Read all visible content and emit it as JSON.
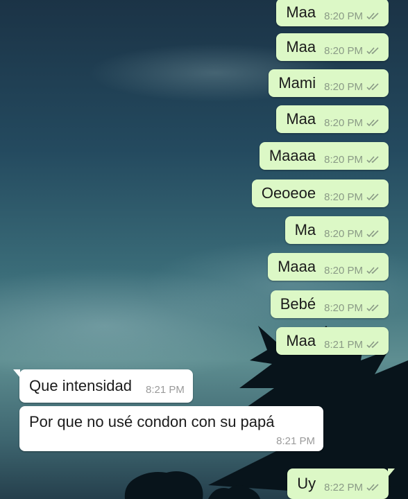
{
  "colors": {
    "outgoing_bubble": "#dcf8c6",
    "incoming_bubble": "#ffffff",
    "tick": "#8a9a86"
  },
  "messages": [
    {
      "direction": "out",
      "text": "Maa",
      "time": "8:20 PM",
      "status": "double-tick-icon"
    },
    {
      "direction": "out",
      "text": "Maa",
      "time": "8:20 PM",
      "status": "double-tick-icon"
    },
    {
      "direction": "out",
      "text": "Mami",
      "time": "8:20 PM",
      "status": "double-tick-icon"
    },
    {
      "direction": "out",
      "text": "Maa",
      "time": "8:20 PM",
      "status": "double-tick-icon"
    },
    {
      "direction": "out",
      "text": "Maaaa",
      "time": "8:20 PM",
      "status": "double-tick-icon"
    },
    {
      "direction": "out",
      "text": "Oeoeoe",
      "time": "8:20 PM",
      "status": "double-tick-icon"
    },
    {
      "direction": "out",
      "text": "Ma",
      "time": "8:20 PM",
      "status": "double-tick-icon"
    },
    {
      "direction": "out",
      "text": "Maaa",
      "time": "8:20 PM",
      "status": "double-tick-icon"
    },
    {
      "direction": "out",
      "text": "Bebé",
      "time": "8:20 PM",
      "status": "double-tick-icon"
    },
    {
      "direction": "out",
      "text": "Maa",
      "time": "8:21 PM",
      "status": "double-tick-icon"
    },
    {
      "direction": "in",
      "text": "Que intensidad",
      "time": "8:21 PM"
    },
    {
      "direction": "in",
      "text": "Por que no usé condon con su papá",
      "time": "8:21 PM"
    },
    {
      "direction": "out",
      "text": "Uy",
      "time": "8:22 PM",
      "status": "double-tick-icon"
    }
  ]
}
